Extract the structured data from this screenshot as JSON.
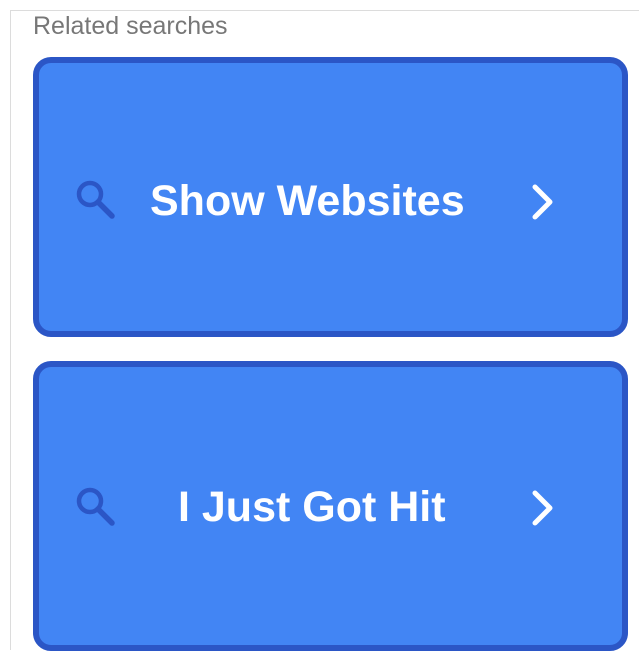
{
  "related_searches": {
    "heading": "Related searches",
    "items": [
      {
        "label": "Show Websites",
        "icon": "search-icon",
        "trailing_icon": "chevron-right-icon"
      },
      {
        "label": "I Just Got Hit",
        "icon": "search-icon",
        "trailing_icon": "chevron-right-icon"
      }
    ],
    "colors": {
      "card_background": "#4285f4",
      "card_border": "#2b56c6",
      "label_text": "#ffffff",
      "search_icon": "#2b56c6",
      "heading_text": "#777777"
    }
  }
}
